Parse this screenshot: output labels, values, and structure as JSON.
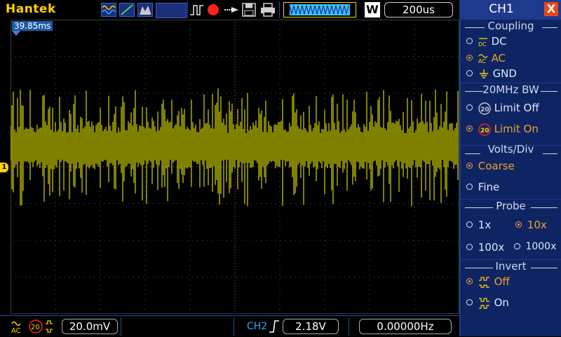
{
  "brand": "Hantek",
  "toolbar": {
    "icons": [
      "math-icon",
      "cursor-icon",
      "measure-icon",
      "screen-icon",
      "trigger-pulse-icon",
      "record-icon",
      "pointer-icon",
      "save-icon",
      "print-icon"
    ],
    "record_color": "#ff2020",
    "w_badge": "W",
    "timebase": "200us"
  },
  "screen": {
    "time_marker": "39.85ms",
    "ch1_marker": "1",
    "trace_color": "#ffff00"
  },
  "bottom": {
    "coupling_icon": "AC",
    "bw_icon": "20",
    "volts_per_div": "20.0mV",
    "ch2_label": "CH2",
    "trigger_level": "2.18V",
    "frequency": "0.00000Hz"
  },
  "panel": {
    "title": "CH1",
    "close": "X",
    "coupling": {
      "title": "Coupling",
      "options": [
        {
          "label": "DC",
          "selected": false,
          "icon": "DC"
        },
        {
          "label": "AC",
          "selected": true,
          "icon": "AC"
        },
        {
          "label": "GND",
          "selected": false,
          "icon": "gnd"
        }
      ]
    },
    "bw": {
      "title": "20MHz BW",
      "options": [
        {
          "label": "Limit Off",
          "selected": false,
          "icon": "20"
        },
        {
          "label": "Limit On",
          "selected": true,
          "icon": "20"
        }
      ]
    },
    "volts": {
      "title": "Volts/Div",
      "options": [
        {
          "label": "Coarse",
          "selected": true
        },
        {
          "label": "Fine",
          "selected": false
        }
      ]
    },
    "probe": {
      "title": "Probe",
      "options": [
        {
          "label": "1x",
          "selected": false
        },
        {
          "label": "10x",
          "selected": true
        },
        {
          "label": "100x",
          "selected": false
        },
        {
          "label": "1000x",
          "selected": false
        }
      ]
    },
    "invert": {
      "title": "Invert",
      "options": [
        {
          "label": "Off",
          "selected": true
        },
        {
          "label": "On",
          "selected": false
        }
      ]
    }
  },
  "colors": {
    "accent_yellow": "#ffd200",
    "panel_blue": "#1d3a8c",
    "panel_section": "#0f2563",
    "selected_orange": "#f0a030"
  }
}
